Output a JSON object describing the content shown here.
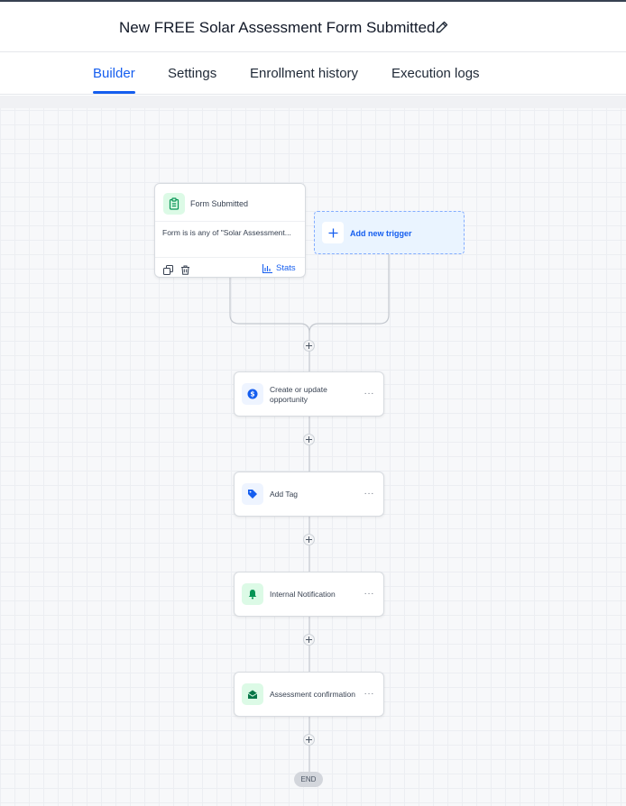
{
  "header": {
    "title": "New FREE Solar Assessment Form Submitted",
    "edit_icon": "pencil-icon"
  },
  "tabs": [
    {
      "label": "Builder",
      "active": true
    },
    {
      "label": "Settings",
      "active": false
    },
    {
      "label": "Enrollment history",
      "active": false
    },
    {
      "label": "Execution logs",
      "active": false
    }
  ],
  "colors": {
    "accent": "#155eef",
    "trigger_icon_bg": "#dcfae6",
    "add_trigger_bg": "#eaf4ff"
  },
  "trigger": {
    "icon": "clipboard-icon",
    "title": "Form Submitted",
    "description": "Form is is any of \"Solar Assessment...",
    "copy_icon": "copy-icon",
    "delete_icon": "trash-icon",
    "stats_icon": "bar-chart-icon",
    "stats_label": "Stats"
  },
  "add_trigger": {
    "icon": "plus-icon",
    "label": "Add new trigger"
  },
  "actions": [
    {
      "label": "Create or update opportunity",
      "icon": "dollar-icon",
      "more": "···"
    },
    {
      "label": "Add Tag",
      "icon": "tag-icon",
      "more": "···"
    },
    {
      "label": "Internal Notification",
      "icon": "bell-icon",
      "more": "···"
    },
    {
      "label": "Assessment confirmation",
      "icon": "mail-open-icon",
      "more": "···"
    }
  ],
  "end_label": "END"
}
